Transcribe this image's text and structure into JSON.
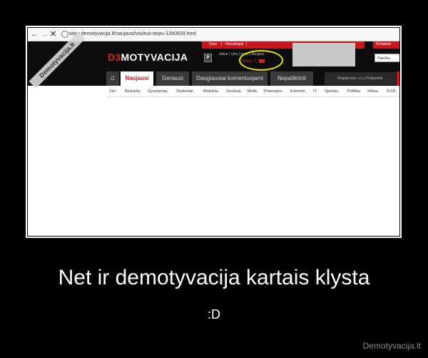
{
  "browser": {
    "back_icon": "arrow-left-icon",
    "forward_icon": "arrow-right-icon",
    "close_icon": "x-icon",
    "url": "www.demotyvacija.lt/naujausi/visi/tuo-tarpu-1390839.html"
  },
  "site": {
    "logo_prefix": "D",
    "logo_number": "3",
    "logo_rest": "MOTYVACIJA",
    "top_links": [
      "Oras",
      "|",
      "Horoskopai",
      "|"
    ],
    "top_right": "Kontaktai",
    "small_links": "dabar | rytoj | poryt | daugiau",
    "weather_text": "Vilnius °C",
    "search_placeholder": "Paieška"
  },
  "tabs": [
    {
      "label": "Naujausi",
      "active": true
    },
    {
      "label": "Geriausi",
      "active": false
    },
    {
      "label": "Daugiausiai komentuojami",
      "active": false
    },
    {
      "label": "Nepatikrinti",
      "active": false
    }
  ],
  "login": {
    "register": "Registruotis",
    "or": "arba",
    "login": "Prisijunkite"
  },
  "categories": [
    "Visi:",
    "Betvarkė,",
    "Gyvenimas,",
    "Studentai,",
    "Mokykla,",
    "Gyvūnai,",
    "Meilė,",
    "Pramogos,",
    "Extreme,",
    "IT,",
    "Sportas,",
    "Politika,",
    "Stilius,",
    "N-18"
  ],
  "watermark": "Demotyvacija.lt",
  "caption": {
    "title": "Net ir demotyvacija kartais klysta",
    "subtitle": ":D"
  },
  "footer": {
    "brand": "Demotyvacija.lt"
  },
  "colors": {
    "accent_red": "#c6191f",
    "highlight_circle": "#e8e400",
    "background": "#000000"
  }
}
